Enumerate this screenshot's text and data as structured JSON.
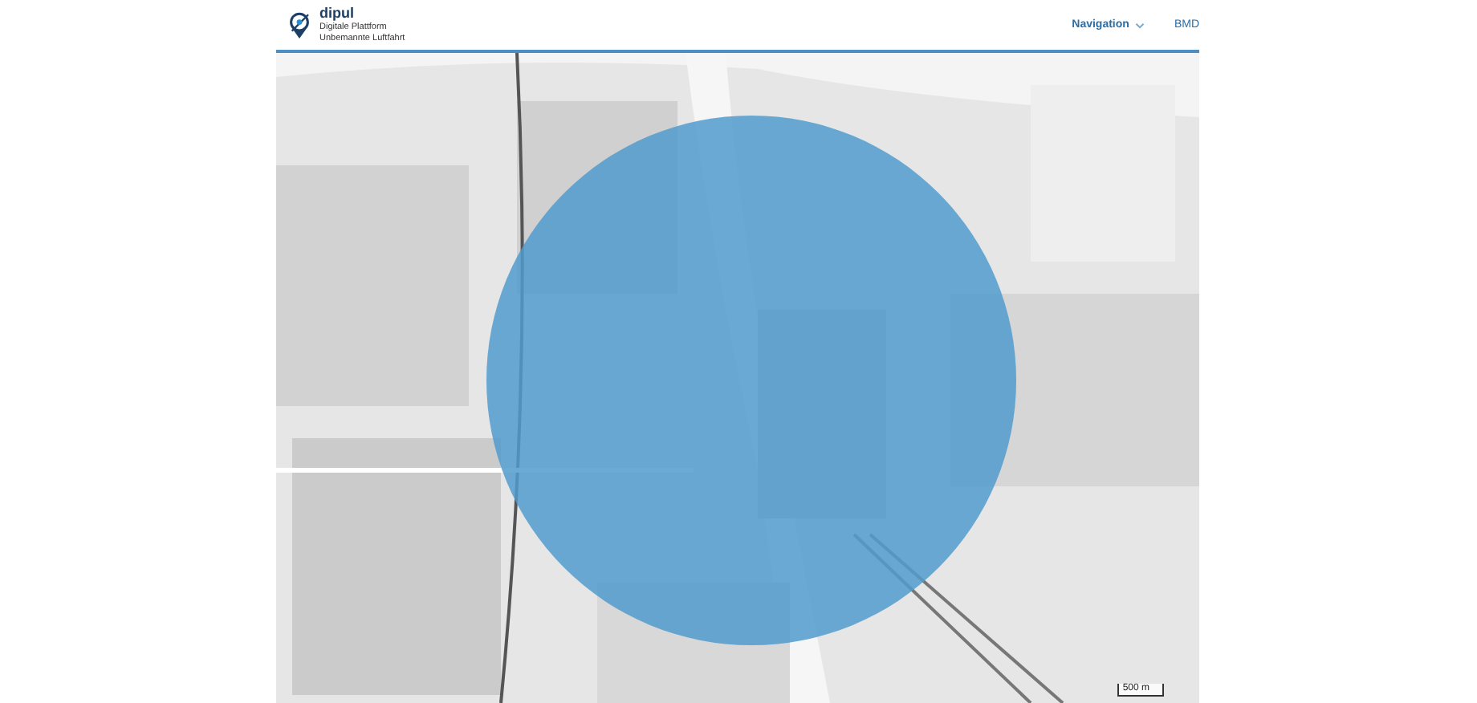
{
  "header": {
    "brand": "dipul",
    "subtitle": [
      "Digitale Plattform",
      "Unbemannte Luftfahrt"
    ],
    "nav": [
      {
        "label": "Navigation",
        "has_menu": true
      },
      {
        "label": "BMD",
        "has_menu": false
      }
    ]
  },
  "map": {
    "scale": "500 m"
  }
}
